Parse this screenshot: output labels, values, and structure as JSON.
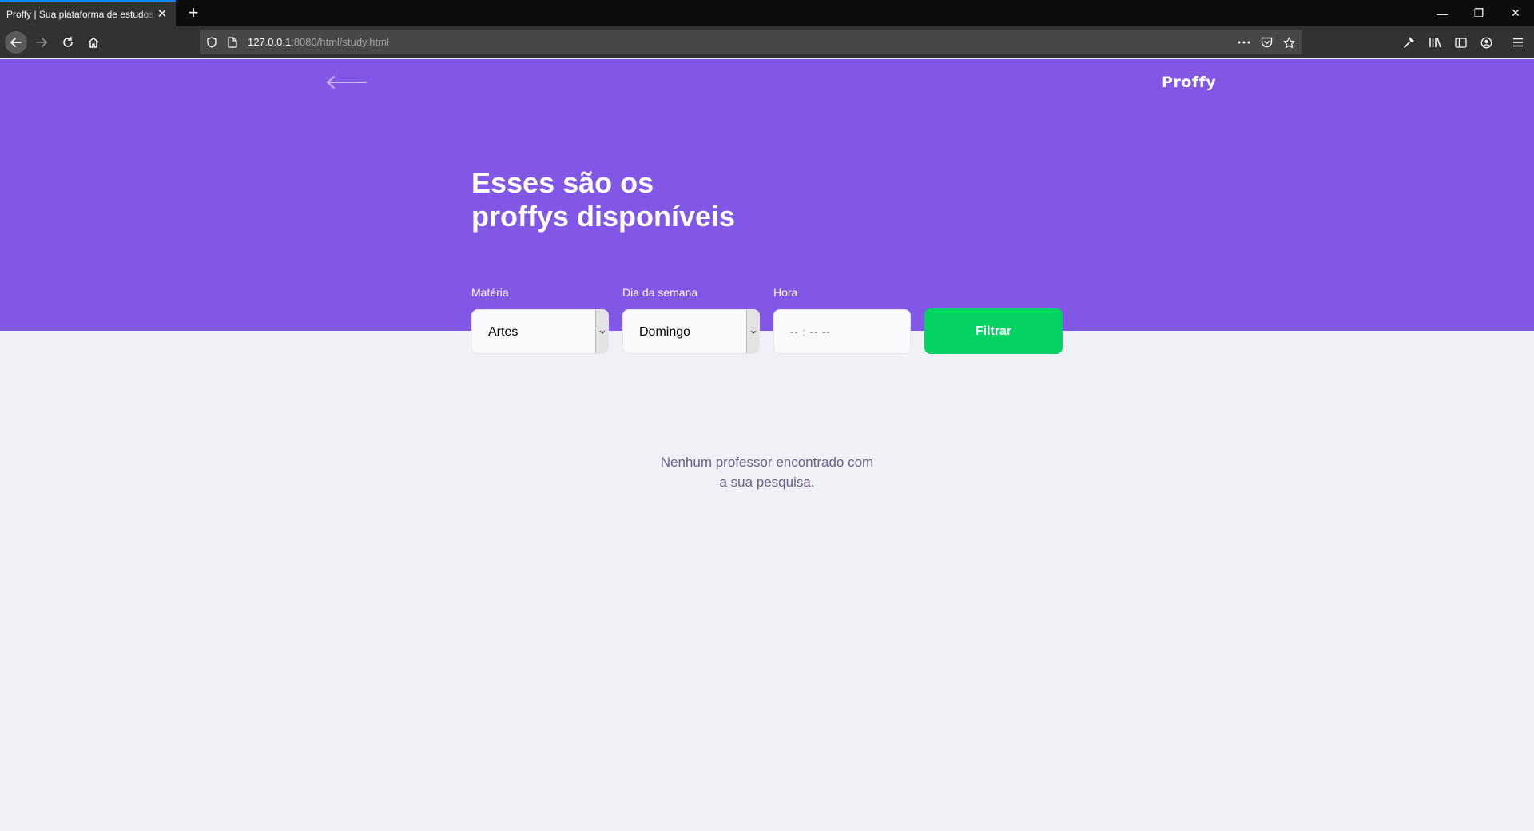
{
  "browser": {
    "tab_title": "Proffy | Sua plataforma de estudos online",
    "tab_close": "✕",
    "new_tab": "+",
    "url_host": "127.0.0.1",
    "url_rest": ":8080/html/study.html",
    "window_controls": [
      "—",
      "❐",
      "✕"
    ],
    "icons": [
      "back-icon",
      "forward-icon",
      "reload-icon",
      "home-icon",
      "shield-icon",
      "page-icon",
      "more-icon",
      "pocket-icon",
      "star-icon",
      "wrench-icon",
      "library-icon",
      "sidebar-icon",
      "account-icon",
      "menu-icon"
    ]
  },
  "page": {
    "logo": "Proffy",
    "title_line1": "Esses são os",
    "title_line2": "proffys disponíveis",
    "filters": {
      "subject_label": "Matéria",
      "subject_value": "Artes",
      "weekday_label": "Dia da semana",
      "weekday_value": "Domingo",
      "time_label": "Hora",
      "time_placeholder": "-- : --  --",
      "submit_label": "Filtrar"
    },
    "empty_line1": "Nenhum professor encontrado com",
    "empty_line2": "a sua pesquisa."
  },
  "colors": {
    "primary": "#8257e5",
    "secondary": "#04d361",
    "background": "#f0f0f7",
    "text_complement": "#6a6180"
  }
}
